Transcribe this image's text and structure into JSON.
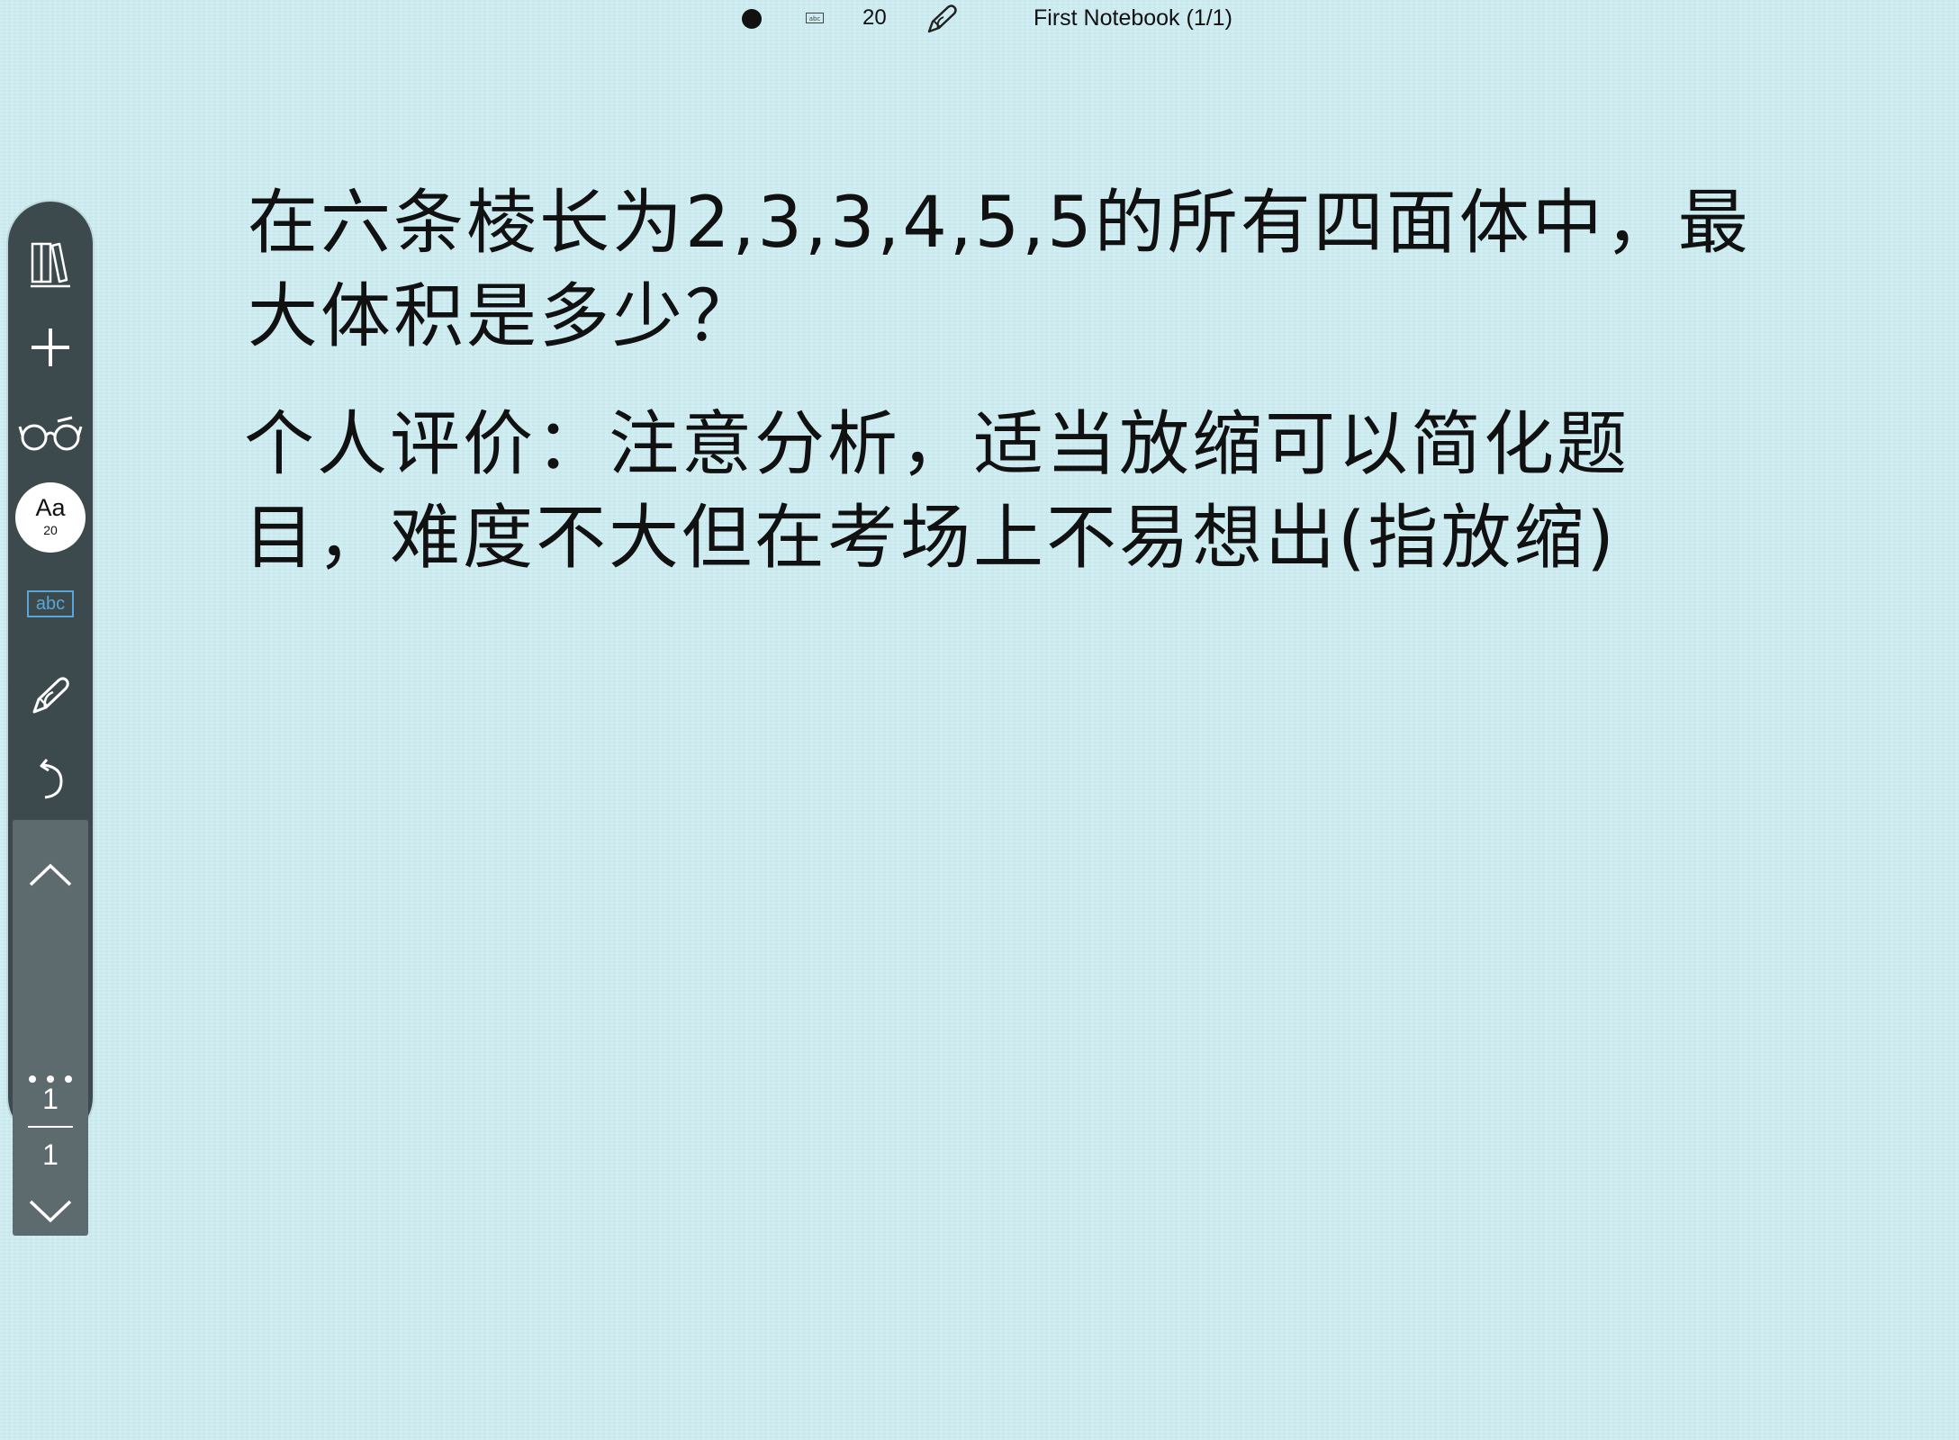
{
  "topbar": {
    "abc_label": "abc",
    "font_size": "20",
    "notebook_title": "First Notebook (1/1)"
  },
  "sidebar": {
    "font_label": "Aa",
    "font_size": "20",
    "textbox_label": "abc",
    "current_page": "1",
    "total_pages": "1",
    "icons": [
      "library-icon",
      "add-icon",
      "glasses-icon",
      "font-size-icon",
      "text-box-icon",
      "pen-icon",
      "undo-icon",
      "page-up-icon",
      "page-down-icon",
      "more-icon"
    ]
  },
  "content": {
    "question": "在六条棱长为2,3,3,4,5,5的所有四面体中，最大体积是多少？",
    "comment": "个人评价：注意分析，适当放缩可以简化题目，难度不大但在考场上不易想出(指放缩)"
  },
  "colors": {
    "background": "#cdedf2",
    "sidebar": "#3c4a4e",
    "page_nav": "#5d6b6f",
    "accent": "#5aa6d8"
  }
}
